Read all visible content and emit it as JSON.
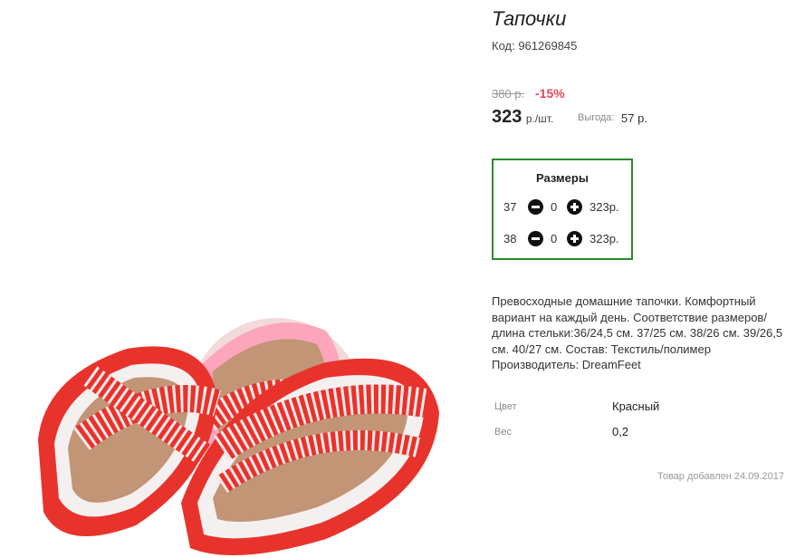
{
  "product": {
    "title": "Тапочки",
    "code": "Код: 961269845",
    "image_alt": "slippers-photo"
  },
  "pricing": {
    "old_price": "380 р.",
    "discount": "-15%",
    "price": "323",
    "unit": "р./шт.",
    "saving_label": "Выгода:",
    "saving_value": "57 р."
  },
  "sizes": {
    "title": "Размеры",
    "rows": [
      {
        "size": "37",
        "qty": "0",
        "price": "323р."
      },
      {
        "size": "38",
        "qty": "0",
        "price": "323р."
      }
    ]
  },
  "description": "Превосходные домашние тапочки. Комфортный вариант на каждый день. Соответствие размеров/длина стельки:36/24,5 см. 37/25 см. 38/26 см. 39/26,5 см. 40/27 см. Состав: Текстиль/полимер Производитель: DreamFeet",
  "properties": [
    {
      "label": "Цвет",
      "value": "Красный"
    },
    {
      "label": "Вес",
      "value": "0,2"
    }
  ],
  "added": "Товар добавлен 24.09.2017",
  "colors": {
    "discount": "#e8455a",
    "sizes_border": "#2c8a2c",
    "slipper_red": "#e8332c"
  }
}
